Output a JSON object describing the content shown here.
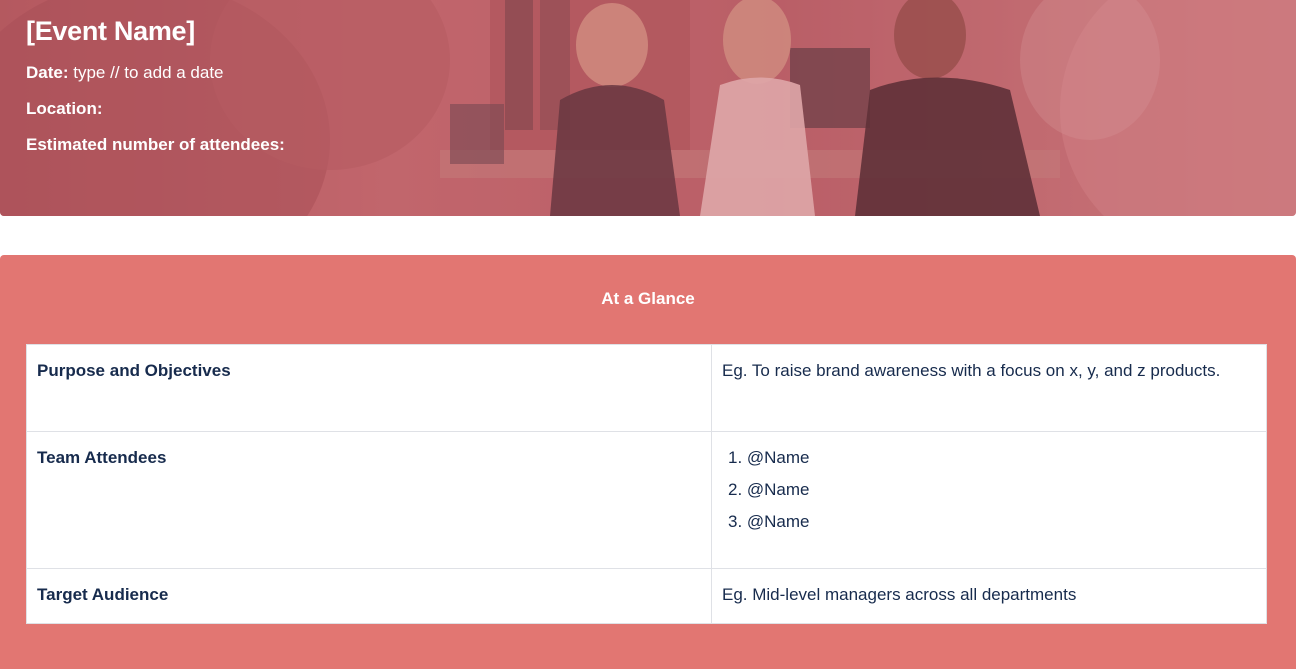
{
  "hero": {
    "title": "[Event Name]",
    "date_label": "Date:",
    "date_value": " type // to add a date",
    "location_label": "Location:",
    "attendees_label": "Estimated number of attendees:"
  },
  "glance": {
    "title": "At a Glance",
    "rows": [
      {
        "label": "Purpose and Objectives",
        "value": "Eg. To raise brand awareness with a focus on x, y, and z products."
      },
      {
        "label": "Team Attendees",
        "items": [
          "1. @Name",
          "2. @Name",
          "3. @Name"
        ]
      },
      {
        "label": "Target Audience",
        "value": "Eg. Mid-level managers across all departments"
      }
    ]
  },
  "colors": {
    "panel": "#e27672",
    "hero_tint": "#be5860",
    "text_dark": "#172b4d",
    "border": "#dfe1e6"
  }
}
